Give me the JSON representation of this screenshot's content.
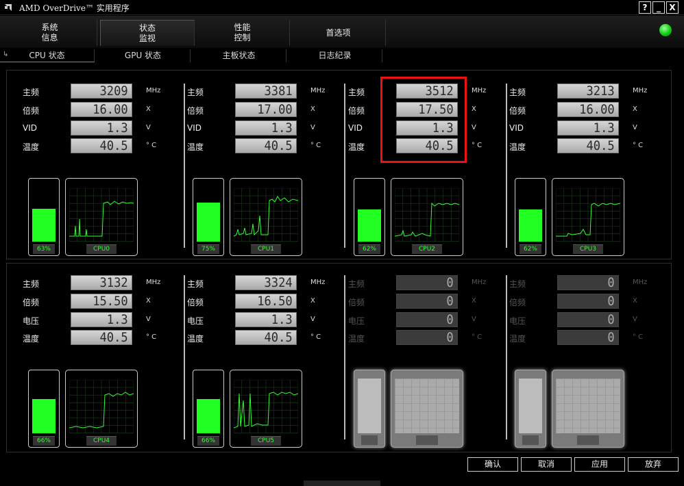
{
  "window": {
    "title": "AMD OverDrive™ 实用程序",
    "buttons": {
      "help": "?",
      "minimize": "_",
      "close": "X"
    }
  },
  "main_tabs": [
    {
      "label": "系统\n信息"
    },
    {
      "label": "状态\n监视"
    },
    {
      "label": "性能\n控制"
    },
    {
      "label": "首选项"
    }
  ],
  "sub_tabs": [
    {
      "label": "CPU 状态"
    },
    {
      "label": "GPU 状态"
    },
    {
      "label": "主板状态"
    },
    {
      "label": "日志纪录"
    }
  ],
  "cores": [
    {
      "rows": [
        {
          "label": "主频",
          "value": "3209",
          "unit": "MHz"
        },
        {
          "label": "倍频",
          "value": "16.00",
          "unit": "X"
        },
        {
          "label": "VID",
          "value": "1.3",
          "unit": "V"
        },
        {
          "label": "温度",
          "value": "40.5",
          "unit": "° C"
        }
      ],
      "load_percent": 63,
      "load_text": "63%",
      "name": "CPU0"
    },
    {
      "rows": [
        {
          "label": "主频",
          "value": "3381",
          "unit": "MHz"
        },
        {
          "label": "倍频",
          "value": "17.00",
          "unit": "X"
        },
        {
          "label": "VID",
          "value": "1.3",
          "unit": "V"
        },
        {
          "label": "温度",
          "value": "40.5",
          "unit": "° C"
        }
      ],
      "load_percent": 75,
      "load_text": "75%",
      "name": "CPU1"
    },
    {
      "rows": [
        {
          "label": "主频",
          "value": "3512",
          "unit": "MHz"
        },
        {
          "label": "倍频",
          "value": "17.50",
          "unit": "X"
        },
        {
          "label": "VID",
          "value": "1.3",
          "unit": "V"
        },
        {
          "label": "温度",
          "value": "40.5",
          "unit": "° C"
        }
      ],
      "load_percent": 62,
      "load_text": "62%",
      "name": "CPU2"
    },
    {
      "rows": [
        {
          "label": "主频",
          "value": "3213",
          "unit": "MHz"
        },
        {
          "label": "倍频",
          "value": "16.00",
          "unit": "X"
        },
        {
          "label": "VID",
          "value": "1.3",
          "unit": "V"
        },
        {
          "label": "温度",
          "value": "40.5",
          "unit": "° C"
        }
      ],
      "load_percent": 62,
      "load_text": "62%",
      "name": "CPU3"
    },
    {
      "rows": [
        {
          "label": "主频",
          "value": "3132",
          "unit": "MHz"
        },
        {
          "label": "倍频",
          "value": "15.50",
          "unit": "X"
        },
        {
          "label": "电压",
          "value": "1.3",
          "unit": "V"
        },
        {
          "label": "温度",
          "value": "40.5",
          "unit": "° C"
        }
      ],
      "load_percent": 66,
      "load_text": "66%",
      "name": "CPU4"
    },
    {
      "rows": [
        {
          "label": "主频",
          "value": "3324",
          "unit": "MHz"
        },
        {
          "label": "倍频",
          "value": "16.50",
          "unit": "X"
        },
        {
          "label": "电压",
          "value": "1.3",
          "unit": "V"
        },
        {
          "label": "温度",
          "value": "40.5",
          "unit": "° C"
        }
      ],
      "load_percent": 66,
      "load_text": "66%",
      "name": "CPU5"
    },
    {
      "rows": [
        {
          "label": "主频",
          "value": "0",
          "unit": "MHz"
        },
        {
          "label": "倍频",
          "value": "0",
          "unit": "X"
        },
        {
          "label": "电压",
          "value": "0",
          "unit": "V"
        },
        {
          "label": "温度",
          "value": "0",
          "unit": "° C"
        }
      ]
    },
    {
      "rows": [
        {
          "label": "主频",
          "value": "0",
          "unit": "MHz"
        },
        {
          "label": "倍频",
          "value": "0",
          "unit": "X"
        },
        {
          "label": "电压",
          "value": "0",
          "unit": "V"
        },
        {
          "label": "温度",
          "value": "0",
          "unit": "° C"
        }
      ]
    }
  ],
  "buttons": {
    "ok": "确认",
    "cancel": "取消",
    "apply": "应用",
    "discard": "放弃"
  },
  "colors": {
    "accent_green": "#22ff22",
    "highlight_red": "#ee1111",
    "status_indicator": "#11cc11"
  }
}
